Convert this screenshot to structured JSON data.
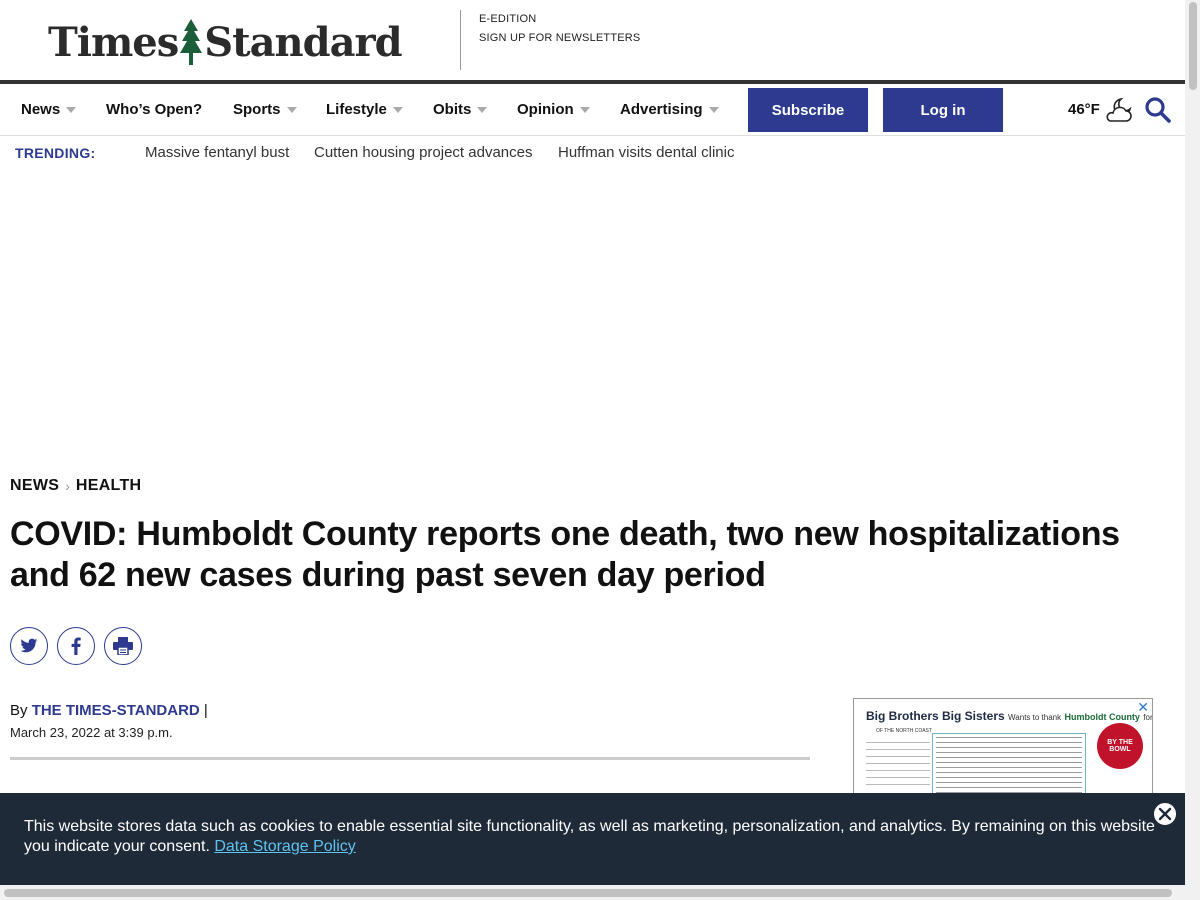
{
  "header": {
    "logo_left": "Times",
    "logo_right": "Standard",
    "links": [
      "E-EDITION",
      "SIGN UP FOR NEWSLETTERS"
    ]
  },
  "nav": {
    "items": [
      {
        "label": "News",
        "dropdown": true
      },
      {
        "label": "Who’s Open?",
        "dropdown": false
      },
      {
        "label": "Sports",
        "dropdown": true
      },
      {
        "label": "Lifestyle",
        "dropdown": true
      },
      {
        "label": "Obits",
        "dropdown": true
      },
      {
        "label": "Opinion",
        "dropdown": true
      },
      {
        "label": "Advertising",
        "dropdown": true
      }
    ],
    "subscribe_label": "Subscribe",
    "login_label": "Log in",
    "temperature": "46°F",
    "weather_icon": "partly-cloudy-night-icon",
    "accent_color": "#2d3a8f"
  },
  "trending": {
    "label": "TRENDING:",
    "links": [
      "Massive fentanyl bust",
      "Cutten housing project advances",
      "Huffman visits dental clinic"
    ]
  },
  "article": {
    "breadcrumb": [
      "NEWS",
      "HEALTH"
    ],
    "headline": "COVID: Humboldt County reports one death, two new hospitalizations and 62 new cases during past seven day period",
    "share_icons": [
      "twitter-icon",
      "facebook-icon",
      "print-icon"
    ],
    "byline_prefix": "By",
    "author": "THE TIMES-STANDARD",
    "byline_suffix": "|",
    "date": "March 23, 2022 at 3:39 p.m."
  },
  "ad": {
    "title": "Big Brothers Big Sisters",
    "subtitle": "OF THE NORTH COAST",
    "thanks": "Wants to thank",
    "county": "Humboldt County",
    "for": "for",
    "badge": "BY THE BOWL"
  },
  "cookie_banner": {
    "text": "This website stores data such as cookies to enable essential site functionality, as well as marketing, personalization, and analytics. By remaining on this website you indicate your consent.",
    "link_label": "Data Storage Policy"
  }
}
